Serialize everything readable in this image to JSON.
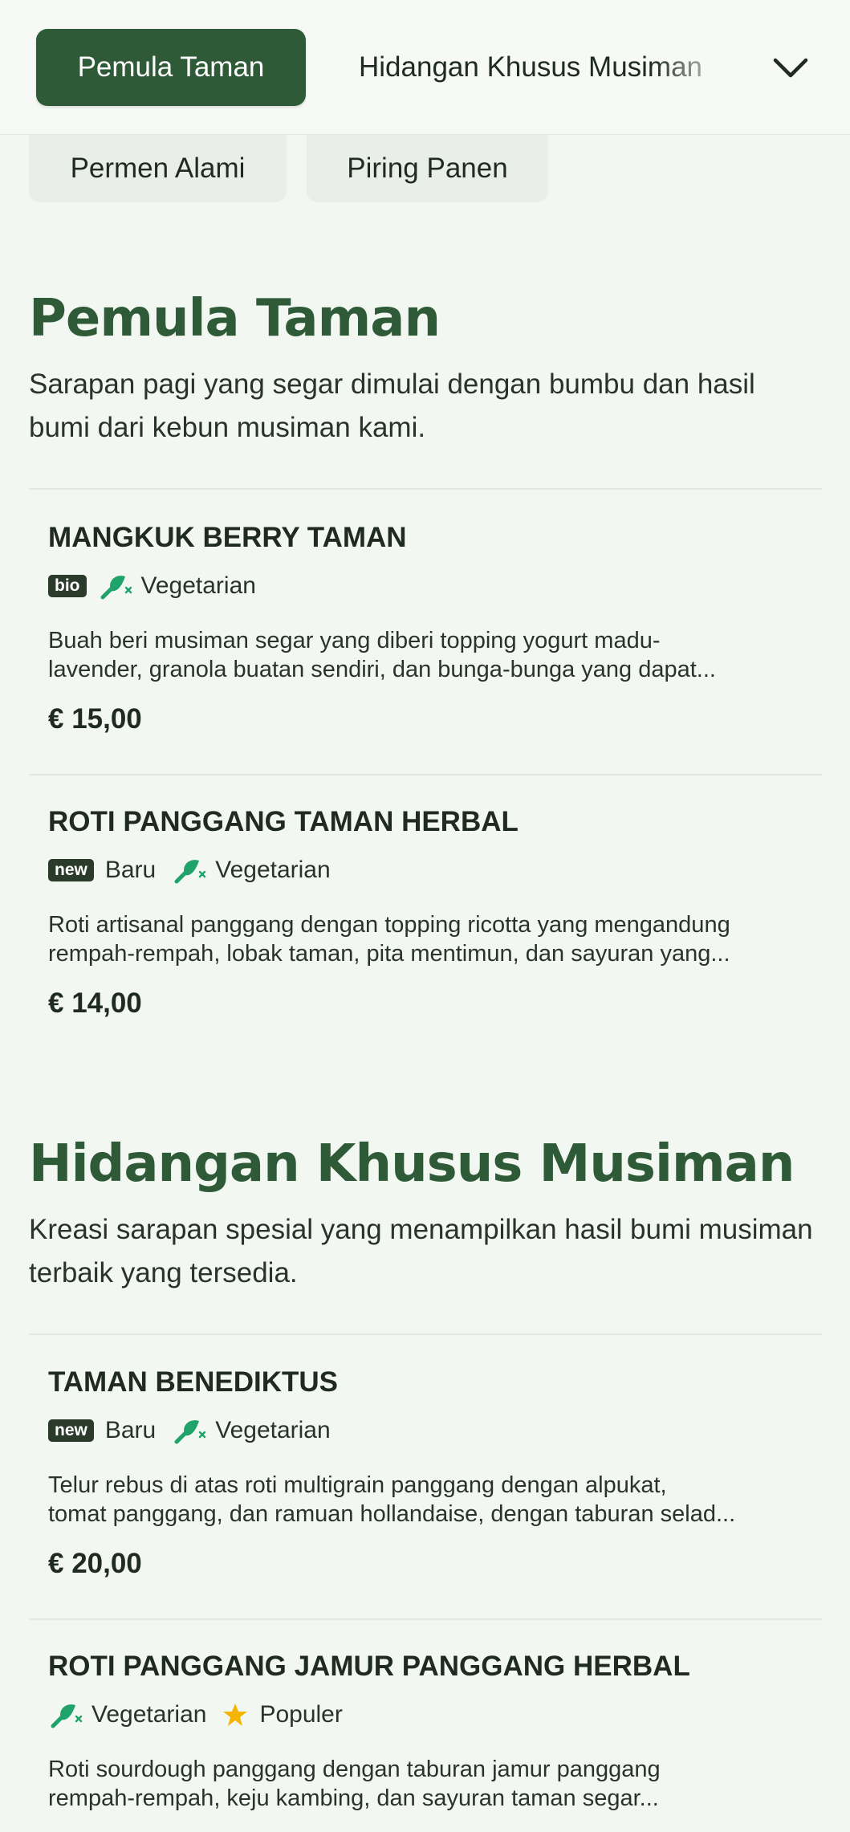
{
  "nav": {
    "active_tab": "Pemula Taman",
    "next_tab": "Hidangan Khusus Musiman",
    "chips": [
      "Permen Alami",
      "Piring Panen"
    ]
  },
  "sections": [
    {
      "title": "Pemula Taman",
      "description": "Sarapan pagi yang segar dimulai dengan bumbu dan hasil bumi dari kebun musiman kami.",
      "items": [
        {
          "name": "MANGKUK BERRY TAMAN",
          "badges": [
            "bio",
            "Vegetarian"
          ],
          "desc_lines": [
            "Buah beri musiman segar yang diberi topping yogurt madu-",
            "lavender, granola buatan sendiri, dan bunga-bunga yang dapat..."
          ],
          "price": "€ 15,00"
        },
        {
          "name": "ROTI PANGGANG TAMAN HERBAL",
          "badges": [
            "new",
            "Baru",
            "Vegetarian"
          ],
          "desc_lines": [
            "Roti artisanal panggang dengan topping ricotta yang mengandung",
            "rempah-rempah, lobak taman, pita mentimun, dan sayuran yang..."
          ],
          "price": "€ 14,00"
        }
      ]
    },
    {
      "title": "Hidangan Khusus Musiman",
      "description": "Kreasi sarapan spesial yang menampilkan hasil bumi musiman terbaik yang tersedia.",
      "items": [
        {
          "name": "TAMAN BENEDIKTUS",
          "badges": [
            "new",
            "Baru",
            "Vegetarian"
          ],
          "desc_lines": [
            "Telur rebus di atas roti multigrain panggang dengan alpukat,",
            "tomat panggang, dan ramuan hollandaise, dengan taburan selad..."
          ],
          "price": "€ 20,00"
        },
        {
          "name": "ROTI PANGGANG JAMUR PANGGANG HERBAL",
          "badges": [
            "Vegetarian",
            "Populer"
          ],
          "desc_lines": [
            "Roti sourdough panggang dengan taburan jamur panggang",
            "rempah-rempah, keju kambing, dan sayuran taman segar..."
          ],
          "price": ""
        }
      ]
    }
  ],
  "colors": {
    "brand_green": "#2e5a37",
    "veg_icon": "#1fa36a",
    "star": "#f4b400",
    "background": "#f3f7f2"
  },
  "icons": {
    "veg": "vegetarian-leaf-icon",
    "star": "star-icon",
    "chevron": "chevron-down-icon"
  }
}
